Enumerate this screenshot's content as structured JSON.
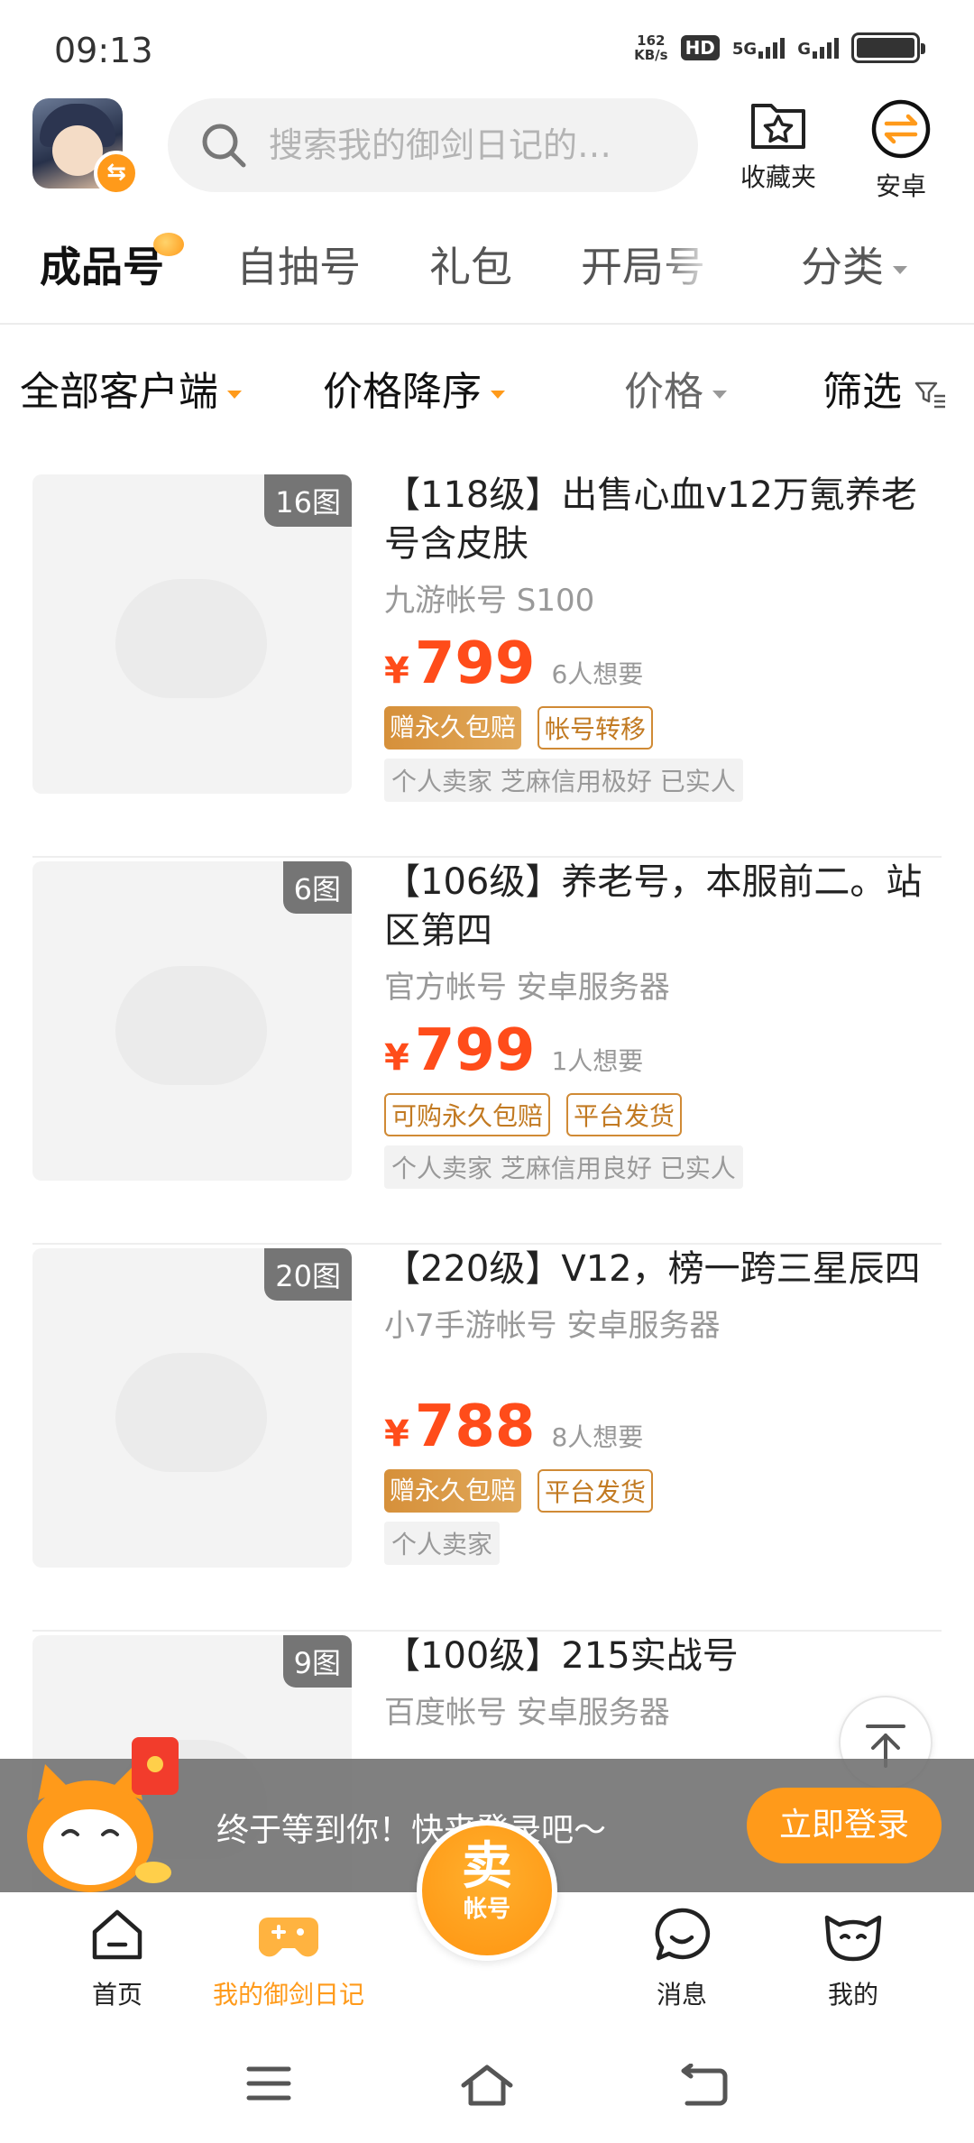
{
  "status_bar": {
    "time": "09:13",
    "net_speed_value": "162",
    "net_speed_unit": "KB/s",
    "hd_label": "HD",
    "sim1_network": "5G",
    "sim2_network": "G"
  },
  "header": {
    "search_placeholder": "搜索我的御剑日记的…",
    "favorites_label": "收藏夹",
    "platform_label": "安卓"
  },
  "tabs": [
    {
      "label": "成品号",
      "active": true
    },
    {
      "label": "自抽号",
      "active": false
    },
    {
      "label": "礼包",
      "active": false
    },
    {
      "label": "开局号",
      "active": false
    },
    {
      "label": "分类",
      "active": false
    }
  ],
  "filters": {
    "client": "全部客户端",
    "sort": "价格降序",
    "price": "价格",
    "screen": "筛选"
  },
  "listings": [
    {
      "image_count": "16图",
      "title": "【118级】出售心血v12万氪养老号含皮肤",
      "subtitle": "九游帐号 S100",
      "currency": "¥",
      "price": "799",
      "wanted": "6人想要",
      "tags": [
        {
          "text": "赠永久包赔",
          "style": "solid"
        },
        {
          "text": "帐号转移",
          "style": "outline"
        }
      ],
      "seller": "个人卖家  芝麻信用极好  已实人"
    },
    {
      "image_count": "6图",
      "title": "【106级】养老号，本服前二。站区第四",
      "subtitle": "官方帐号 安卓服务器",
      "currency": "¥",
      "price": "799",
      "wanted": "1人想要",
      "tags": [
        {
          "text": "可购永久包赔",
          "style": "outline"
        },
        {
          "text": "平台发货",
          "style": "outline"
        }
      ],
      "seller": "个人卖家  芝麻信用良好  已实人"
    },
    {
      "image_count": "20图",
      "title": "【220级】V12，榜一跨三星辰四",
      "subtitle": "小7手游帐号 安卓服务器",
      "currency": "¥",
      "price": "788",
      "wanted": "8人想要",
      "tags": [
        {
          "text": "赠永久包赔",
          "style": "solid"
        },
        {
          "text": "平台发货",
          "style": "outline"
        }
      ],
      "seller": "个人卖家"
    },
    {
      "image_count": "9图",
      "title": "【100级】215实战号",
      "subtitle": "百度帐号 安卓服务器",
      "currency": "¥",
      "price": "",
      "wanted": "",
      "tags": [],
      "seller": ""
    }
  ],
  "login_banner": {
    "text": "终于等到你！快来登录吧～",
    "button": "立即登录"
  },
  "bottom_nav": {
    "home": "首页",
    "my_game": "我的御剑日记",
    "sell_top": "卖",
    "sell_bottom": "帐号",
    "messages": "消息",
    "mine": "我的"
  },
  "colors": {
    "accent": "#ff9a1a",
    "price": "#ff4c1a",
    "tag_border": "#d08a35"
  }
}
